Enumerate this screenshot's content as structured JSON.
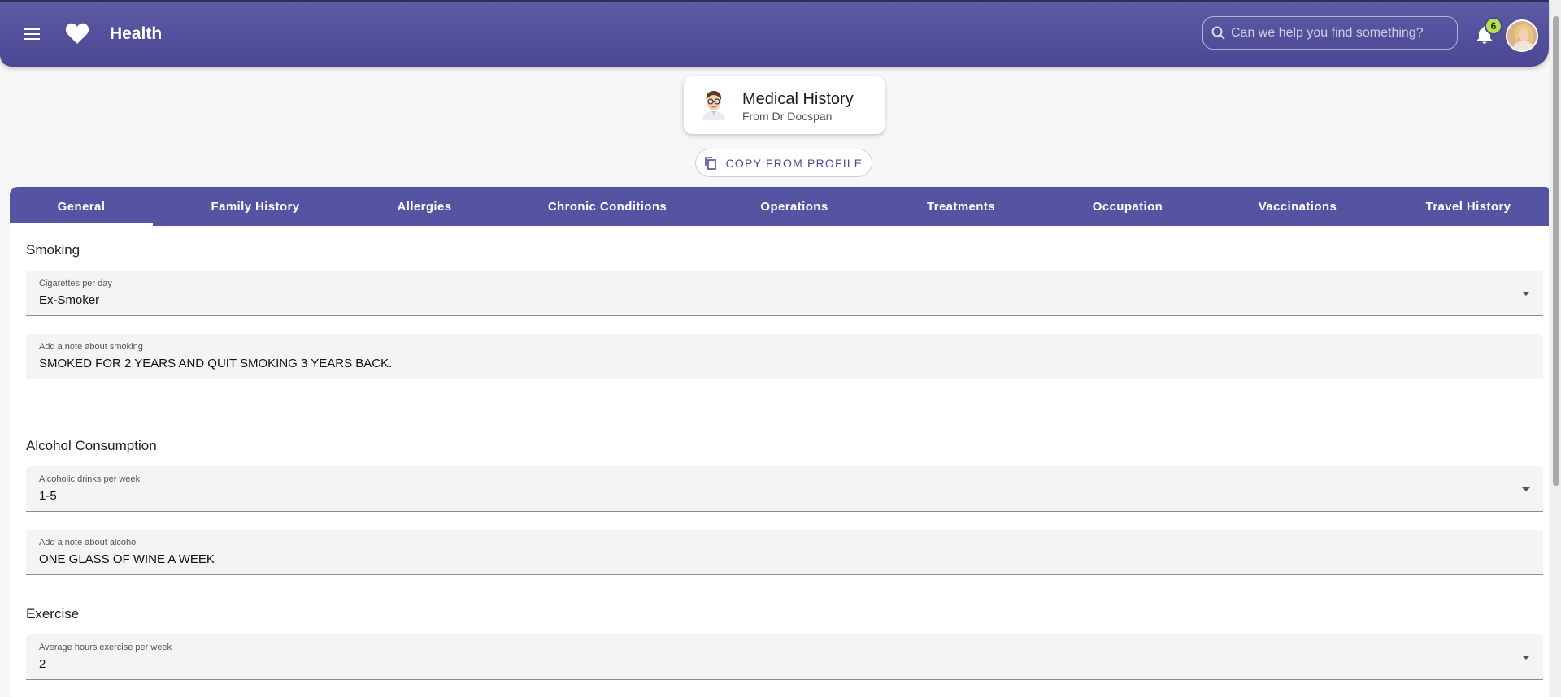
{
  "app": {
    "title": "Health",
    "search_placeholder": "Can we help you find something?",
    "notification_count": "6"
  },
  "header_card": {
    "title": "Medical History",
    "subtitle": "From Dr Docspan"
  },
  "copy_button": {
    "label": "COPY FROM PROFILE"
  },
  "tabs": [
    {
      "label": "General",
      "active": true
    },
    {
      "label": "Family History"
    },
    {
      "label": "Allergies"
    },
    {
      "label": "Chronic Conditions"
    },
    {
      "label": "Operations"
    },
    {
      "label": "Treatments"
    },
    {
      "label": "Occupation"
    },
    {
      "label": "Vaccinations"
    },
    {
      "label": "Travel History"
    }
  ],
  "sections": {
    "smoking": {
      "title": "Smoking",
      "select": {
        "label": "Cigarettes per day",
        "value": "Ex-Smoker"
      },
      "note": {
        "label": "Add a note about smoking",
        "value": "SMOKED FOR 2 YEARS AND QUIT SMOKING 3 YEARS BACK."
      }
    },
    "alcohol": {
      "title": "Alcohol Consumption",
      "select": {
        "label": "Alcoholic drinks per week",
        "value": "1-5"
      },
      "note": {
        "label": "Add a note about alcohol",
        "value": "ONE GLASS OF WINE A WEEK"
      }
    },
    "exercise": {
      "title": "Exercise",
      "select": {
        "label": "Average hours exercise per week",
        "value": "2"
      }
    }
  },
  "colors": {
    "primary": "#5554a2",
    "badge": "#b3e34b",
    "field_bg": "#f4f4f4"
  },
  "icons": [
    "menu-icon",
    "heart-icon",
    "search-icon",
    "bell-icon",
    "copy-icon",
    "chevron-down-icon"
  ]
}
